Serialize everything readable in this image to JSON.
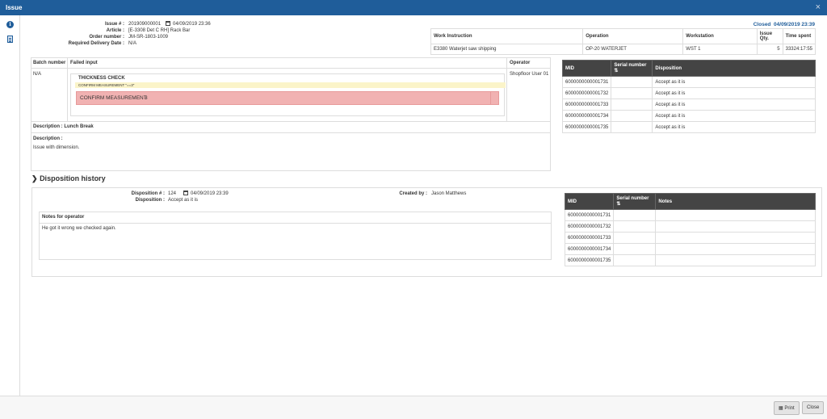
{
  "window": {
    "title": "Issue",
    "close_glyph": "×"
  },
  "issue": {
    "issue_label": "Issue # :",
    "issue_value": "201909000001",
    "issue_time": "04/09/2019 23:36",
    "article_label": "Article :",
    "article_value": "[E-3308 Det C RH] Rack Bar",
    "order_label": "Order number :",
    "order_value": "JM-SR-1803-1009",
    "delivery_label": "Required Delivery Date :",
    "delivery_value": "N/A",
    "status": "Closed",
    "status_time": "04/09/2019 23:39"
  },
  "work_table": {
    "headers": [
      "Work Instruction",
      "Operation",
      "Workstation",
      "Issue Qty.",
      "Time spent"
    ],
    "row": [
      "E3380 Waterjet saw shipping",
      "OP-20 WATERJET",
      "WST 1",
      "5",
      "33324:17:55"
    ]
  },
  "failed": {
    "batch_header": "Batch number",
    "failed_header": "Failed input",
    "operator_header": "Operator",
    "batch_value": "N/A",
    "operator_value": "Shopfloor User 01",
    "check_title": "THICKNESS CHECK",
    "check_rule": "CONFIRM MEASUREMENT \"==3\"",
    "measure_label": "CONFIRM MEASUREMENT",
    "measure_value": "3",
    "desc1": "Description : Lunch Break",
    "desc2_label": "Description :",
    "desc2_value": "Issue with dimension."
  },
  "mid_table": {
    "headers": [
      "MID",
      "Serial number",
      "Disposition"
    ],
    "rows": [
      [
        "6000000000001731",
        "",
        "Accept as it is"
      ],
      [
        "6000000000001732",
        "",
        "Accept as it is"
      ],
      [
        "6000000000001733",
        "",
        "Accept as it is"
      ],
      [
        "6000000000001734",
        "",
        "Accept as it is"
      ],
      [
        "6000000000001735",
        "",
        "Accept as it is"
      ]
    ]
  },
  "history": {
    "title": "Disposition history",
    "disp_label": "Disposition # :",
    "disp_value": "124",
    "disp_time": "04/09/2019 23:39",
    "disposition_label": "Disposition :",
    "disposition_value": "Accept as it is",
    "created_label": "Created by :",
    "created_value": "Jason Matthews",
    "notes_title": "Notes for operator",
    "notes_value": "He got it wrong we checked again."
  },
  "notes_table": {
    "headers": [
      "MID",
      "Serial number",
      "Notes"
    ],
    "rows": [
      [
        "6000000000001731",
        "",
        ""
      ],
      [
        "6000000000001732",
        "",
        ""
      ],
      [
        "6000000000001733",
        "",
        ""
      ],
      [
        "6000000000001734",
        "",
        ""
      ],
      [
        "6000000000001735",
        "",
        ""
      ]
    ]
  },
  "footer": {
    "print": "Print",
    "close": "Close"
  },
  "icons": {
    "calendar": "calendar-icon",
    "sort": "sort-icon",
    "printer": "printer-icon"
  }
}
